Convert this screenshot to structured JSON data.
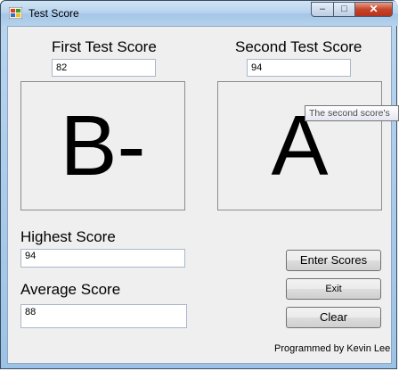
{
  "window": {
    "title": "Test Score",
    "controls": {
      "minimize": "–",
      "maximize": "□",
      "close": "✕"
    }
  },
  "first": {
    "label": "First Test Score",
    "value": "82",
    "grade": "B-"
  },
  "second": {
    "label": "Second Test Score",
    "value": "94",
    "grade": "A"
  },
  "highest": {
    "label": "Highest Score",
    "value": "94"
  },
  "average": {
    "label": "Average Score",
    "value": "88"
  },
  "buttons": {
    "enter": "Enter Scores",
    "exit": "Exit",
    "clear": "Clear"
  },
  "tooltip": "The second score's",
  "credit": "Programmed by Kevin Lee",
  "colors": {
    "titlebar": "#b8d4ee",
    "client": "#efefef",
    "close_button": "#c4452a"
  }
}
